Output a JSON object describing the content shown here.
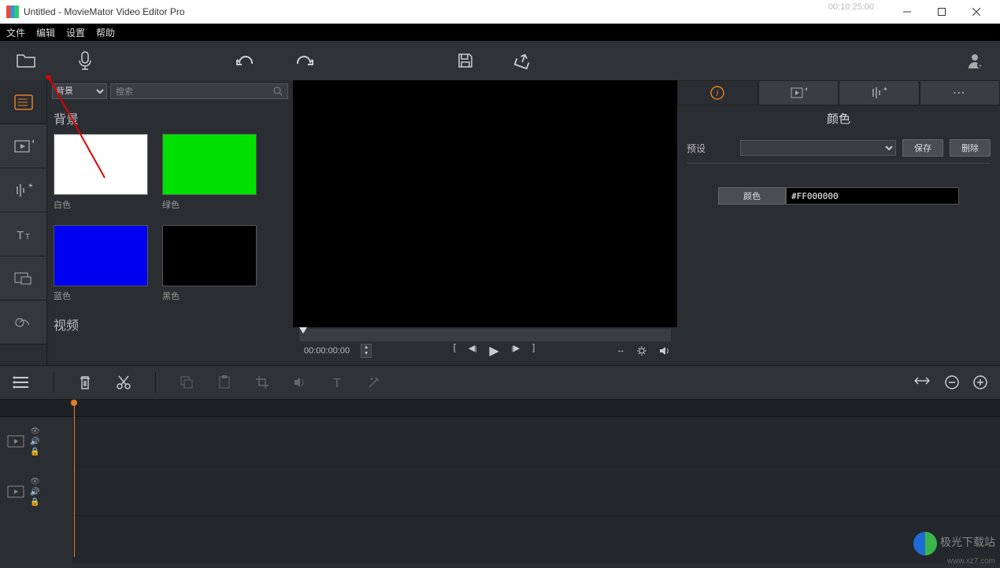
{
  "window": {
    "title": "Untitled - MovieMator Video Editor Pro"
  },
  "menu": {
    "file": "文件",
    "edit": "编辑",
    "settings": "设置",
    "help": "帮助"
  },
  "media": {
    "category_selected": "背景",
    "search_placeholder": "搜索",
    "section_bg": "背景",
    "section_video": "视频",
    "items": {
      "white": "白色",
      "green": "绿色",
      "blue": "蓝色",
      "black": "黑色"
    }
  },
  "preview": {
    "current_time": "00:00:00:00",
    "total_time": "00:10:25:00"
  },
  "props": {
    "title": "颜色",
    "preset_label": "预设",
    "save_btn": "保存",
    "delete_btn": "删除",
    "color_btn": "颜色",
    "color_value": "#FF000000"
  },
  "watermark": {
    "name": "极光下载站",
    "url": "www.xz7.com"
  }
}
